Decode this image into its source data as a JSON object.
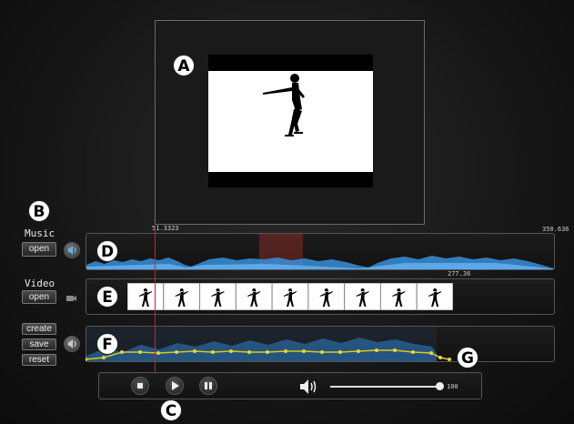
{
  "callouts": {
    "a": "A",
    "b": "B",
    "c": "C",
    "d": "D",
    "e": "E",
    "f": "F",
    "g": "G"
  },
  "music": {
    "label": "Music",
    "open_label": "open",
    "playhead_time": "51.3323",
    "duration": "350.636"
  },
  "video": {
    "label": "Video",
    "open_label": "open",
    "duration": "277.36",
    "thumbnail_count": 9
  },
  "envelope": {
    "create_label": "create",
    "save_label": "save",
    "reset_label": "reset"
  },
  "transport": {
    "stop": "stop-icon",
    "play": "play-icon",
    "pause": "pause-icon",
    "volume_value": "100",
    "volume_fraction": 1.0
  },
  "colors": {
    "waveform": "#3a8fd8",
    "playhead": "#d42020",
    "envelope_line": "#d8c820",
    "highlight": "#c0392b"
  }
}
